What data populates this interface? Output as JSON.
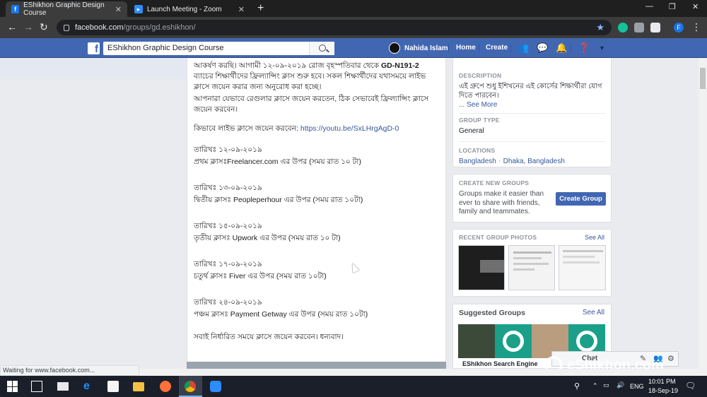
{
  "browser": {
    "tabs": [
      {
        "title": "EShikhon Graphic Design Course",
        "active": true
      },
      {
        "title": "Launch Meeting - Zoom",
        "active": false
      }
    ],
    "url_domain": "facebook.com",
    "url_path": "/groups/gd.eshikhon/",
    "status_text": "Waiting for www.facebook.com...",
    "profile_initial": "F"
  },
  "fb": {
    "search_value": "EShikhon Graphic Design Course",
    "user_name": "Nahida Islam",
    "nav_home": "Home",
    "nav_create": "Create"
  },
  "post": {
    "line1": "আকর্ষণ করছি। আগামী ১২-০৯-২০১৯ রোজ বৃহস্পতিবার  থেকে ",
    "line1_bold": "GD-N191-2",
    "line2": "ব্যাচের শিক্ষার্থীদের ফ্রিল্যান্সিং ক্লাস শুরু হবে। সকল শিক্ষার্থীদের যথাসময়ে লাইভ ক্লাসে জয়েন করার জন্য অনুরোধ করা হচ্ছে।",
    "line3": "আপনারা যেভাবে রেগুলার ক্লাসে জয়েন করতেন, ঠিক সেভাবেই ফ্রিল্যান্সিং  ক্লাসে জয়েন করবেন।",
    "howto_label": "কিভাবে লাইভ ক্লাসে জয়েন করবেন: ",
    "howto_link": "https://youtu.be/SxLHrgAgD-0",
    "schedule": [
      {
        "date": "তারিখঃ ১২-০৯-২০১৯",
        "class": "প্রথম ক্লাসঃFreelancer.com এর উপর (সময় রাত ১০ টা)"
      },
      {
        "date": "তারিখঃ ১৩-০৯-২০১৯",
        "class": "দ্বিতীয় ক্লাসঃ Peopleperhour  এর উপর (সময় রাত ১০টা)"
      },
      {
        "date": "তারিখঃ ১৫-০৯-২০১৯",
        "class": "তৃতীয় ক্লাসঃ Upwork এর উপর (সময় রাত ১০ টা)"
      },
      {
        "date": "তারিখঃ ১৭-০৯-২০১৯",
        "class": "চতুর্থ ক্লাসঃ Fiver এর উপর (সময় রাত ১০টা)"
      },
      {
        "date": "তারিখঃ ২৪-০৯-২০১৯",
        "class": "পঞ্চম ক্লাসঃ Payment Getway এর উপর (সময় রাত ১০টা)"
      }
    ],
    "closing": "সবাই নির্ধারিত সময়ে ক্লাসে জয়েন করবেন। ধন্যবাদ।"
  },
  "about": {
    "description_label": "DESCRIPTION",
    "description_text": "এই গ্রুপে শুধু ইশিখনের এই কোর্সের শিক্ষার্থীরা যোগ দিতে পারবেন।",
    "see_more": "... See More",
    "group_type_label": "GROUP TYPE",
    "group_type": "General",
    "locations_label": "LOCATIONS",
    "location_1": "Bangladesh",
    "location_sep": " · ",
    "location_2": "Dhaka, Bangladesh"
  },
  "create_groups": {
    "label": "CREATE NEW GROUPS",
    "text": "Groups make it easier than ever to share with friends, family and teammates.",
    "button": "Create Group"
  },
  "recent_photos": {
    "label": "RECENT GROUP PHOTOS",
    "see_all": "See All"
  },
  "suggested": {
    "title": "Suggested Groups",
    "see_all": "See All",
    "group_name": "EShikhon Search Engine"
  },
  "chat": {
    "label": "Chat"
  },
  "watermark": {
    "text": "eShikhon.com"
  },
  "taskbar": {
    "lang": "ENG",
    "time": "10:01 PM",
    "date": "18-Sep-19"
  }
}
